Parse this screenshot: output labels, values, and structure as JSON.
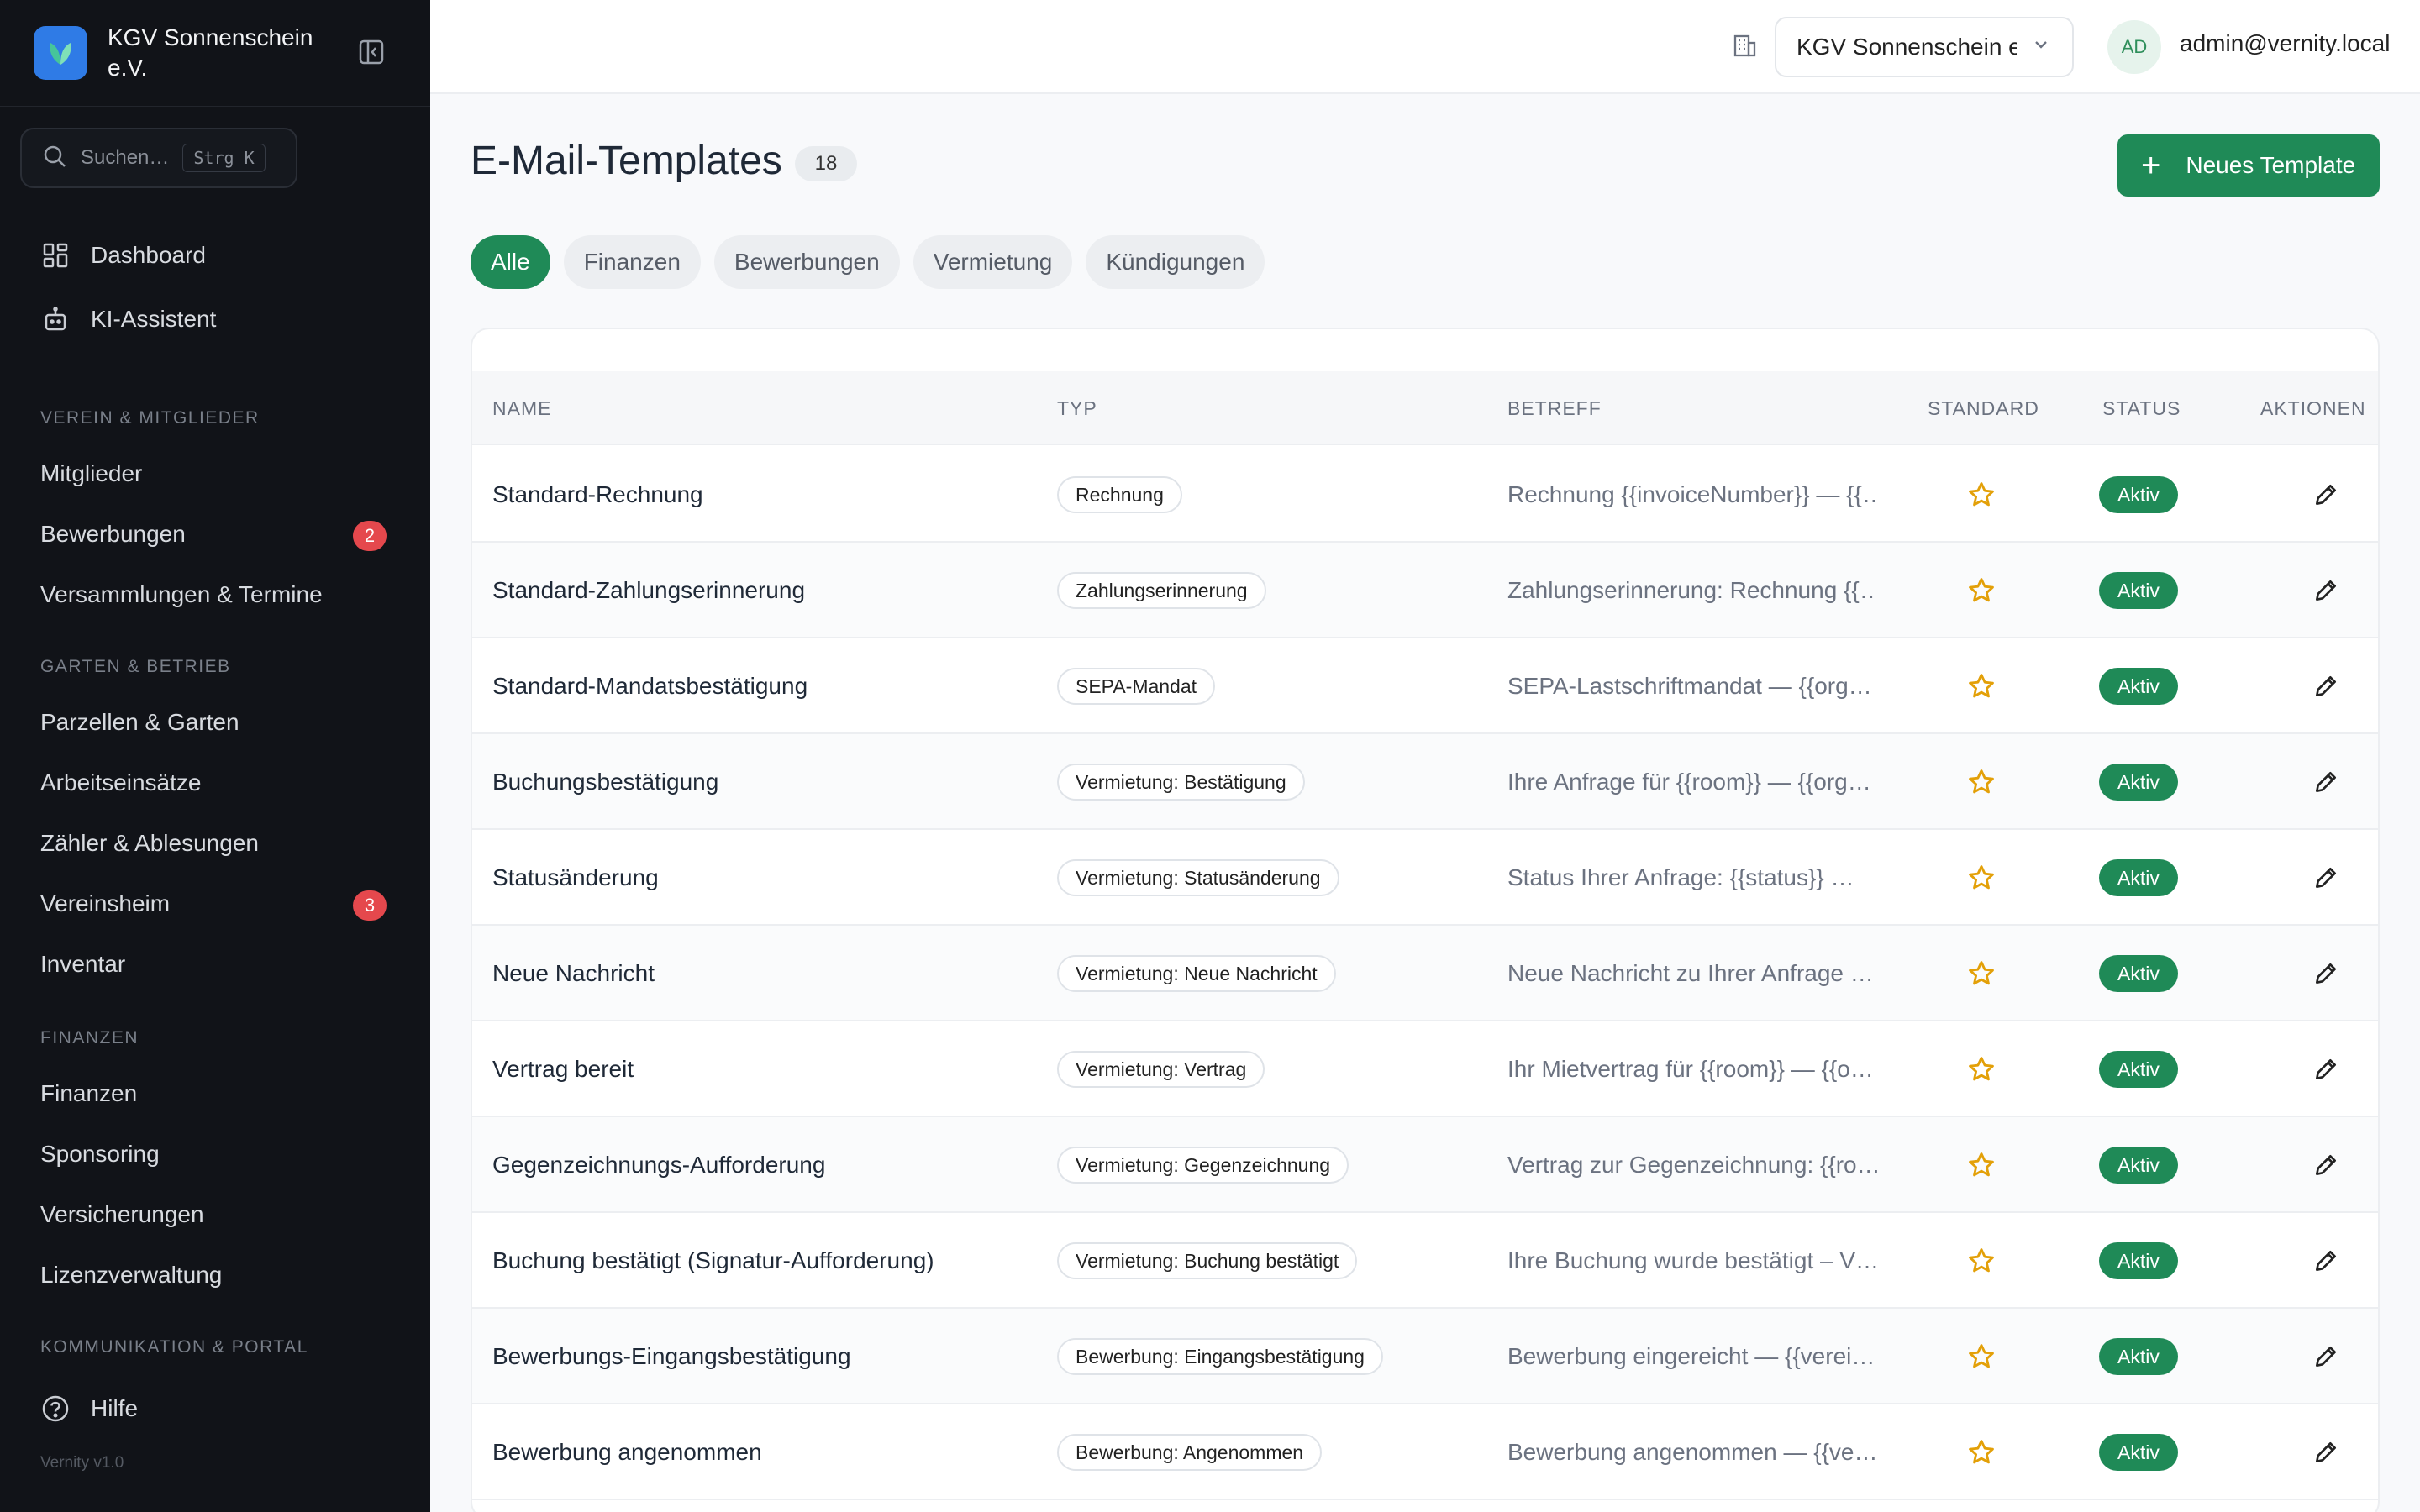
{
  "sidebar": {
    "org_name": "KGV Sonnenschein e.V.",
    "search_placeholder": "Suchen…",
    "search_shortcut": "Strg K",
    "top_items": [
      {
        "label": "Dashboard",
        "icon": "dashboard-icon"
      },
      {
        "label": "KI-Assistent",
        "icon": "robot-icon"
      }
    ],
    "sections": [
      {
        "title": "VEREIN & MITGLIEDER",
        "items": [
          {
            "label": "Mitglieder"
          },
          {
            "label": "Bewerbungen",
            "badge": "2"
          },
          {
            "label": "Versammlungen & Termine"
          }
        ]
      },
      {
        "title": "GARTEN & BETRIEB",
        "items": [
          {
            "label": "Parzellen & Garten"
          },
          {
            "label": "Arbeitseinsätze"
          },
          {
            "label": "Zähler & Ablesungen"
          },
          {
            "label": "Vereinsheim",
            "badge": "3"
          },
          {
            "label": "Inventar"
          }
        ]
      },
      {
        "title": "FINANZEN",
        "items": [
          {
            "label": "Finanzen"
          },
          {
            "label": "Sponsoring"
          },
          {
            "label": "Versicherungen"
          },
          {
            "label": "Lizenzverwaltung"
          }
        ]
      },
      {
        "title": "KOMMUNIKATION & PORTAL",
        "items": []
      }
    ],
    "help_label": "Hilfe",
    "version": "Vernity v1.0"
  },
  "topbar": {
    "org_select": "KGV Sonnenschein e.V.",
    "avatar_initials": "AD",
    "user_email": "admin@vernity.local"
  },
  "page": {
    "title": "E-Mail-Templates",
    "count": "18",
    "new_button": "Neues Template",
    "filters": [
      "Alle",
      "Finanzen",
      "Bewerbungen",
      "Vermietung",
      "Kündigungen"
    ],
    "active_filter": "Alle"
  },
  "table": {
    "columns": [
      "NAME",
      "TYP",
      "BETREFF",
      "STANDARD",
      "STATUS",
      "AKTIONEN"
    ],
    "rows": [
      {
        "name": "Standard-Rechnung",
        "type": "Rechnung",
        "subject": "Rechnung {{invoiceNumber}} — {{…",
        "status": "Aktiv"
      },
      {
        "name": "Standard-Zahlungserinnerung",
        "type": "Zahlungserinnerung",
        "subject": "Zahlungserinnerung: Rechnung {{…",
        "status": "Aktiv"
      },
      {
        "name": "Standard-Mandatsbestätigung",
        "type": "SEPA-Mandat",
        "subject": "SEPA-Lastschriftmandat — {{org…",
        "status": "Aktiv"
      },
      {
        "name": "Buchungsbestätigung",
        "type": "Vermietung: Bestätigung",
        "subject": "Ihre Anfrage für {{room}} — {{org…",
        "status": "Aktiv"
      },
      {
        "name": "Statusänderung",
        "type": "Vermietung: Statusänderung",
        "subject": "Status Ihrer Anfrage: {{status}} …",
        "status": "Aktiv"
      },
      {
        "name": "Neue Nachricht",
        "type": "Vermietung: Neue Nachricht",
        "subject": "Neue Nachricht zu Ihrer Anfrage …",
        "status": "Aktiv"
      },
      {
        "name": "Vertrag bereit",
        "type": "Vermietung: Vertrag",
        "subject": "Ihr Mietvertrag für {{room}} — {{o…",
        "status": "Aktiv"
      },
      {
        "name": "Gegenzeichnungs-Aufforderung",
        "type": "Vermietung: Gegenzeichnung",
        "subject": "Vertrag zur Gegenzeichnung: {{ro…",
        "status": "Aktiv"
      },
      {
        "name": "Buchung bestätigt (Signatur-Aufforderung)",
        "type": "Vermietung: Buchung bestätigt",
        "subject": "Ihre Buchung wurde bestätigt – V…",
        "status": "Aktiv"
      },
      {
        "name": "Bewerbungs-Eingangsbestätigung",
        "type": "Bewerbung: Eingangsbestätigung",
        "subject": "Bewerbung eingereicht — {{verei…",
        "status": "Aktiv"
      },
      {
        "name": "Bewerbung angenommen",
        "type": "Bewerbung: Angenommen",
        "subject": "Bewerbung angenommen — {{ve…",
        "status": "Aktiv"
      }
    ]
  },
  "colors": {
    "sidebar_bg": "#111318",
    "accent_green": "#1f8a57",
    "badge_red": "#e5484d",
    "logo_blue": "#2f7be6",
    "star_amber": "#e3a008"
  }
}
